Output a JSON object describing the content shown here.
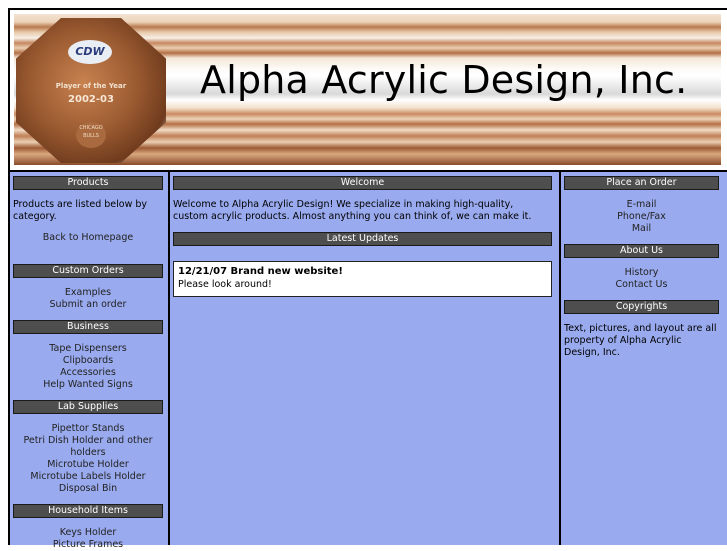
{
  "banner": {
    "title": "Alpha Acrylic Design, Inc.",
    "award": {
      "logo": "CDW",
      "line1": "Player of the Year",
      "line2": "2002-03",
      "line3": "CHICAGO BULLS"
    }
  },
  "left": {
    "products": {
      "header": "Products",
      "intro": "Products are listed below by category.",
      "back_link": "Back to Homepage"
    },
    "custom_orders": {
      "header": "Custom Orders",
      "items": [
        "Examples",
        "Submit an order"
      ]
    },
    "business": {
      "header": "Business",
      "items": [
        "Tape Dispensers",
        "Clipboards",
        "Accessories",
        "Help Wanted Signs"
      ]
    },
    "lab_supplies": {
      "header": "Lab Supplies",
      "items": [
        "Pipettor Stands",
        "Petri Dish Holder and other holders",
        "Microtube Holder",
        "Microtube Labels Holder",
        "Disposal Bin"
      ]
    },
    "household": {
      "header": "Household Items",
      "items": [
        "Keys Holder",
        "Picture Frames"
      ]
    }
  },
  "main": {
    "welcome": {
      "header": "Welcome",
      "text": "Welcome to Alpha Acrylic Design! We specialize in making high-quality, custom acrylic products. Almost anything you can think of, we can make it."
    },
    "updates": {
      "header": "Latest Updates",
      "title": "12/21/07 Brand new website!",
      "body": "Please look around!"
    }
  },
  "right": {
    "order": {
      "header": "Place an Order",
      "items": [
        "E-mail",
        "Phone/Fax",
        "Mail"
      ]
    },
    "about": {
      "header": "About Us",
      "items": [
        "History",
        "Contact Us"
      ]
    },
    "copyrights": {
      "header": "Copyrights",
      "text": "Text, pictures, and layout are all property of Alpha Acrylic Design, Inc."
    }
  },
  "colors": {
    "column_bg": "#99aaee",
    "header_bg": "#4e4e4e",
    "frame": "#000000"
  }
}
